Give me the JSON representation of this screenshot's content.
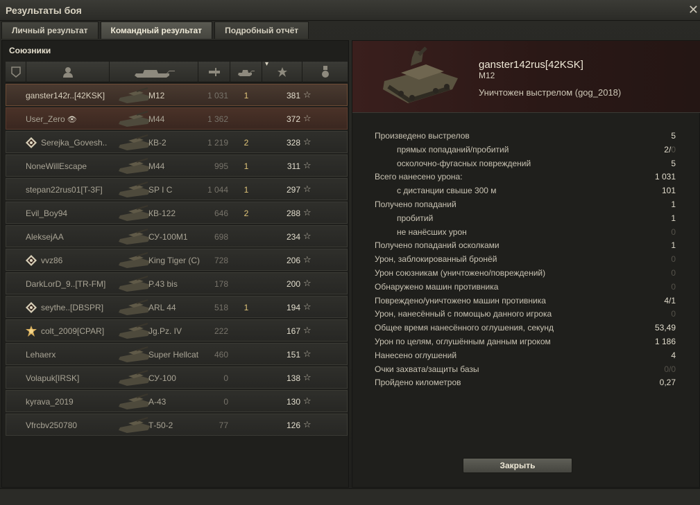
{
  "window": {
    "title": "Результаты боя",
    "close_glyph": "✕"
  },
  "tabs": [
    {
      "label": "Личный результат",
      "active": false
    },
    {
      "label": "Командный результат",
      "active": true
    },
    {
      "label": "Подробный отчёт",
      "active": false
    }
  ],
  "allies": {
    "title": "Союзники",
    "columns": [
      "squad-icon",
      "player-icon",
      "vehicle-icon",
      "damage-icon",
      "kills-icon",
      "xp-star-icon",
      "medal-icon"
    ],
    "sort_indicator": "▾",
    "rows": [
      {
        "name": "ganster142r..[42KSK]",
        "vehicle": "M12",
        "damage": "1 031",
        "kills": "1",
        "xp": "381",
        "star": "☆",
        "badge": "",
        "self": true
      },
      {
        "name": "User_Zero",
        "vehicle": "M44",
        "damage": "1 362",
        "kills": "",
        "xp": "372",
        "star": "☆",
        "badge": "",
        "eye": "👁",
        "platoon": true
      },
      {
        "name": "Serejka_Govesh..",
        "vehicle": "КВ-2",
        "damage": "1 219",
        "kills": "2",
        "xp": "328",
        "star": "☆",
        "badge": "diamond"
      },
      {
        "name": "NoneWillEscape",
        "vehicle": "M44",
        "damage": "995",
        "kills": "1",
        "xp": "311",
        "star": "☆",
        "badge": ""
      },
      {
        "name": "stepan22rus01[T-3F]",
        "vehicle": "SP I C",
        "damage": "1 044",
        "kills": "1",
        "xp": "297",
        "star": "☆",
        "badge": ""
      },
      {
        "name": "Evil_Boy94",
        "vehicle": "КВ-122",
        "damage": "646",
        "kills": "2",
        "xp": "288",
        "star": "☆",
        "badge": ""
      },
      {
        "name": "AleksejAA",
        "vehicle": "СУ-100М1",
        "damage": "698",
        "kills": "",
        "xp": "234",
        "star": "☆",
        "badge": ""
      },
      {
        "name": "vvz86",
        "vehicle": "King Tiger (C)",
        "damage": "728",
        "kills": "",
        "xp": "206",
        "star": "☆",
        "badge": "diamond"
      },
      {
        "name": "DarkLorD_9..[TR-FM]",
        "vehicle": "P.43 bis",
        "damage": "178",
        "kills": "",
        "xp": "200",
        "star": "☆",
        "badge": ""
      },
      {
        "name": "seythe..[DBSPR]",
        "vehicle": "ARL 44",
        "damage": "518",
        "kills": "1",
        "xp": "194",
        "star": "☆",
        "badge": "diamond"
      },
      {
        "name": "colt_2009[CPAR]",
        "vehicle": "Jg.Pz. IV",
        "damage": "222",
        "kills": "",
        "xp": "167",
        "star": "☆",
        "badge": "gold"
      },
      {
        "name": "Lehaerx",
        "vehicle": "Super Hellcat",
        "damage": "460",
        "kills": "",
        "xp": "151",
        "star": "☆",
        "badge": ""
      },
      {
        "name": "Volapuk[IRSK]",
        "vehicle": "СУ-100",
        "damage": "0",
        "kills": "",
        "xp": "138",
        "star": "☆",
        "badge": ""
      },
      {
        "name": "kyrava_2019",
        "vehicle": "А-43",
        "damage": "0",
        "kills": "",
        "xp": "130",
        "star": "☆",
        "badge": ""
      },
      {
        "name": "Vfrcbv250780",
        "vehicle": "Т-50-2",
        "damage": "77",
        "kills": "",
        "xp": "126",
        "star": "☆",
        "badge": ""
      }
    ]
  },
  "detail": {
    "player": "ganster142rus[42KSK]",
    "vehicle": "M12",
    "status": "Уничтожен выстрелом (gog_2018)",
    "stats": [
      {
        "label": "Произведено выстрелов",
        "value": "5",
        "sub": false
      },
      {
        "label": "прямых попаданий/пробитий",
        "value": "2/",
        "value_dim": "0",
        "sub": true
      },
      {
        "label": "осколочно-фугасных повреждений",
        "value": "5",
        "sub": true
      },
      {
        "label": "Всего нанесено урона:",
        "value": "1 031",
        "sub": false
      },
      {
        "label": "с дистанции свыше 300 м",
        "value": "101",
        "sub": true
      },
      {
        "label": "Получено попаданий",
        "value": "1",
        "sub": false
      },
      {
        "label": "пробитий",
        "value": "1",
        "sub": true
      },
      {
        "label": "не нанёсших урон",
        "value": "0",
        "sub": true,
        "dim": true
      },
      {
        "label": "Получено попаданий осколками",
        "value": "1",
        "sub": false
      },
      {
        "label": "Урон, заблокированный бронёй",
        "value": "0",
        "sub": false,
        "dim": true
      },
      {
        "label": "Урон союзникам (уничтожено/повреждений)",
        "value": "0",
        "sub": false,
        "dim": true
      },
      {
        "label": "Обнаружено машин противника",
        "value": "0",
        "sub": false,
        "dim": true
      },
      {
        "label": "Повреждено/уничтожено машин противника",
        "value": "4/1",
        "sub": false
      },
      {
        "label": "Урон, нанесённый с помощью данного игрока",
        "value": "0",
        "sub": false,
        "dim": true
      },
      {
        "label": "Общее время нанесённого оглушения, секунд",
        "value": "53,49",
        "sub": false
      },
      {
        "label": "Урон по целям, оглушённым данным игроком",
        "value": "1 186",
        "sub": false
      },
      {
        "label": "Нанесено оглушений",
        "value": "4",
        "sub": false
      },
      {
        "label": "Очки захвата/защиты базы",
        "value": "0/0",
        "sub": false,
        "dim": true
      },
      {
        "label": "Пройдено километров",
        "value": "0,27",
        "sub": false
      }
    ],
    "close_label": "Закрыть"
  }
}
